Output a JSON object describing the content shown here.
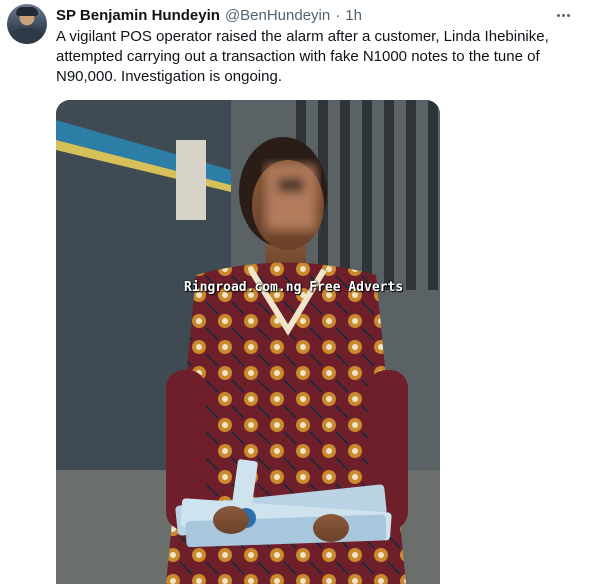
{
  "tweet": {
    "author_name": "SP Benjamin Hundeyin",
    "author_handle": "@BenHundeyin",
    "separator": "·",
    "time": "1h",
    "text": "A vigilant POS operator raised the alarm after a customer, Linda Ihebinike, attempted carrying out a transaction with fake N1000 notes to the tune of N90,000. Investigation is ongoing."
  },
  "media": {
    "watermark": "Ringroad.com.ng Free Adverts"
  },
  "icons": {
    "more": "more-options-icon"
  },
  "colors": {
    "text_primary": "#0f1419",
    "text_secondary": "#536471",
    "background": "#ffffff"
  }
}
